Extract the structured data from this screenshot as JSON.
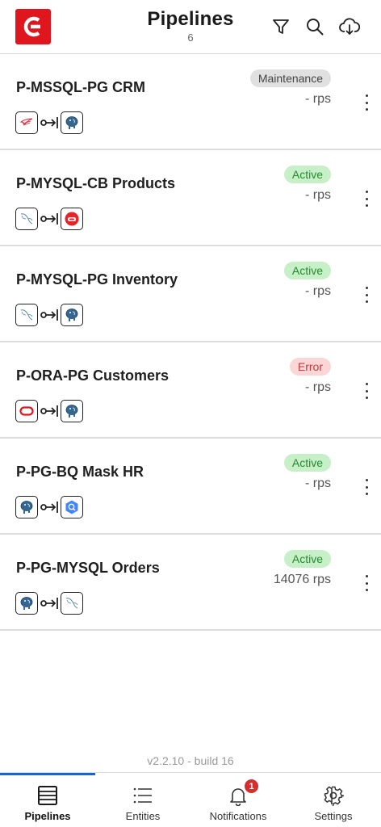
{
  "header": {
    "title": "Pipelines",
    "count": "6"
  },
  "pipelines": [
    {
      "name": "P-MSSQL-PG CRM",
      "status": "Maintenance",
      "status_kind": "maint",
      "rps": "- rps",
      "source": "mssql-icon",
      "target": "postgresql-icon"
    },
    {
      "name": "P-MYSQL-CB Products",
      "status": "Active",
      "status_kind": "active",
      "rps": "- rps",
      "source": "mysql-icon",
      "target": "couchbase-icon"
    },
    {
      "name": "P-MYSQL-PG Inventory",
      "status": "Active",
      "status_kind": "active",
      "rps": "- rps",
      "source": "mysql-icon",
      "target": "postgresql-icon"
    },
    {
      "name": "P-ORA-PG Customers",
      "status": "Error",
      "status_kind": "error",
      "rps": "- rps",
      "source": "oracle-icon",
      "target": "postgresql-icon"
    },
    {
      "name": "P-PG-BQ Mask HR",
      "status": "Active",
      "status_kind": "active",
      "rps": "- rps",
      "source": "postgresql-icon",
      "target": "bigquery-icon"
    },
    {
      "name": "P-PG-MYSQL Orders",
      "status": "Active",
      "status_kind": "active",
      "rps": "14076 rps",
      "source": "postgresql-icon",
      "target": "mysql-icon"
    }
  ],
  "version": "v2.2.10 - build 16",
  "tabs": [
    {
      "label": "Pipelines",
      "icon": "pipelines-icon",
      "active": true
    },
    {
      "label": "Entities",
      "icon": "list-icon",
      "active": false
    },
    {
      "label": "Notifications",
      "icon": "bell-icon",
      "active": false,
      "badge": "1"
    },
    {
      "label": "Settings",
      "icon": "gear-icon",
      "active": false
    }
  ],
  "colors": {
    "brand": "#e0161e",
    "tab_indicator": "#1565d8",
    "active_bg": "#c7f0c9",
    "active_fg": "#238a2c",
    "error_bg": "#fbd6d6",
    "error_fg": "#c23a3a",
    "maint_bg": "#e0e0e0"
  }
}
